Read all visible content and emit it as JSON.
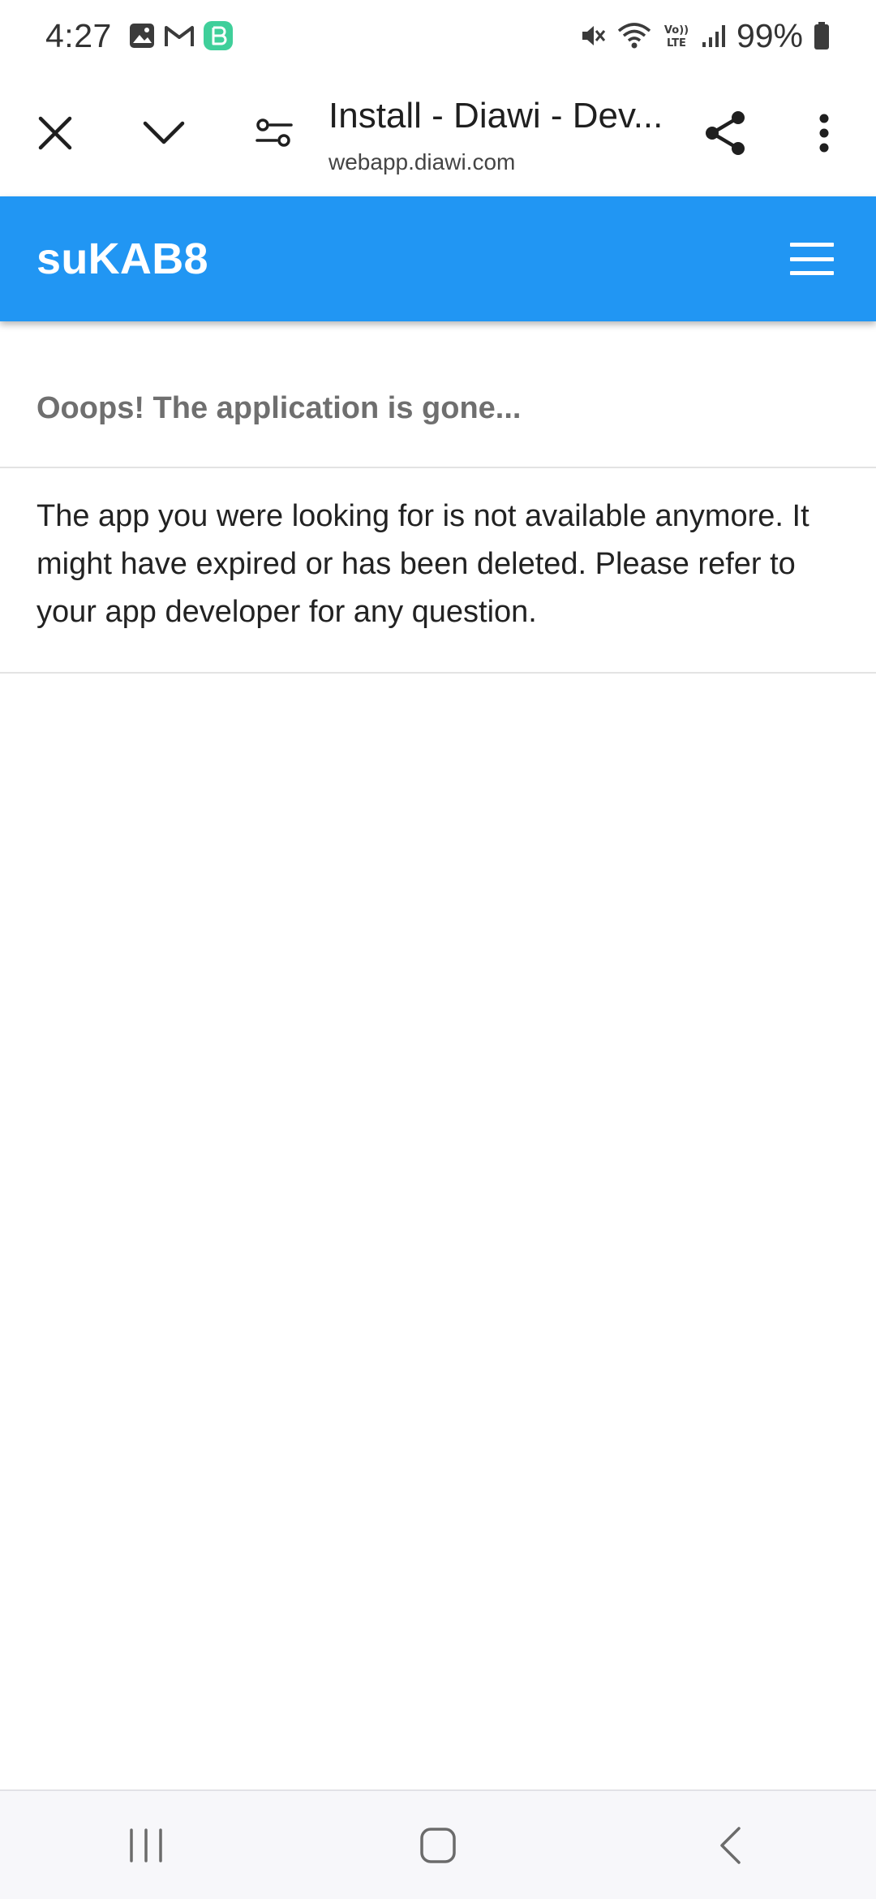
{
  "status_bar": {
    "time": "4:27",
    "battery_percent": "99%",
    "left_icons": [
      "gallery-icon",
      "gmail-icon",
      "app-notification-icon"
    ],
    "right_icons": [
      "mute-icon",
      "wifi-icon",
      "volte-icon",
      "signal-icon",
      "battery-icon"
    ]
  },
  "browser": {
    "page_title": "Install - Diawi - Dev...",
    "url": "webapp.diawi.com"
  },
  "app_bar": {
    "title": "suKAB8",
    "accent_color": "#2196f3"
  },
  "content": {
    "subtitle": "Ooops! The application is gone...",
    "message": "The app you were looking for is not available anymore. It might have expired or has been deleted. Please refer to your app developer for any question."
  }
}
